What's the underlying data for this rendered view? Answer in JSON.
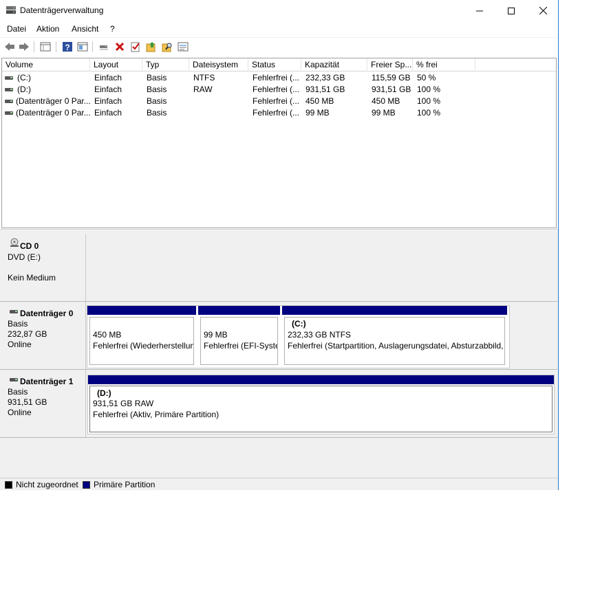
{
  "window": {
    "title": "Datenträgerverwaltung"
  },
  "menu": [
    "Datei",
    "Aktion",
    "Ansicht",
    "?"
  ],
  "toolbar": {
    "icons": [
      "back-icon",
      "forward-icon",
      "disk-list-icon",
      "help-icon",
      "properties-icon",
      "connect-icon",
      "delete-icon",
      "check-icon",
      "folder-up-icon",
      "folder-search-icon",
      "settings-list-icon"
    ],
    "colors": {
      "delete": "#cc1111",
      "help": "#2b4f9e",
      "folder": "#f2c14e"
    }
  },
  "volumes": {
    "columns": [
      "Volume",
      "Layout",
      "Typ",
      "Dateisystem",
      "Status",
      "Kapazität",
      "Freier Sp...",
      "% frei"
    ],
    "rows": [
      [
        "(C:)",
        "Einfach",
        "Basis",
        "NTFS",
        "Fehlerfrei (...",
        "232,33 GB",
        "115,59 GB",
        "50 %"
      ],
      [
        "(D:)",
        "Einfach",
        "Basis",
        "RAW",
        "Fehlerfrei (...",
        "931,51 GB",
        "931,51 GB",
        "100 %"
      ],
      [
        "(Datenträger 0 Par...",
        "Einfach",
        "Basis",
        "",
        "Fehlerfrei (...",
        "450 MB",
        "450 MB",
        "100 %"
      ],
      [
        "(Datenträger 0 Par...",
        "Einfach",
        "Basis",
        "",
        "Fehlerfrei (...",
        "99 MB",
        "99 MB",
        "100 %"
      ]
    ]
  },
  "disks": {
    "cd0": {
      "name": "CD 0",
      "line1": "DVD (E:)",
      "line2": "Kein Medium"
    },
    "disk0": {
      "name": "Datenträger 0",
      "type": "Basis",
      "size": "232,87 GB",
      "state": "Online",
      "partitions": [
        {
          "line1": "450 MB",
          "line2": "Fehlerfrei (Wiederherstellun"
        },
        {
          "line1": "99 MB",
          "line2": "Fehlerfrei (EFI-Syster"
        },
        {
          "title": "(C:)",
          "line1": "232,33 GB NTFS",
          "line2": "Fehlerfrei (Startpartition, Auslagerungsdatei, Absturzabbild,"
        }
      ]
    },
    "disk1": {
      "name": "Datenträger 1",
      "type": "Basis",
      "size": "931,51 GB",
      "state": "Online",
      "partitions": [
        {
          "title": "(D:)",
          "line1": "931,51 GB RAW",
          "line2": "Fehlerfrei (Aktiv, Primäre Partition)"
        }
      ]
    }
  },
  "legend": {
    "unallocated": "Nicht zugeordnet",
    "primary": "Primäre Partition",
    "colors": {
      "unallocated": "#000000",
      "primary": "#000080"
    }
  }
}
